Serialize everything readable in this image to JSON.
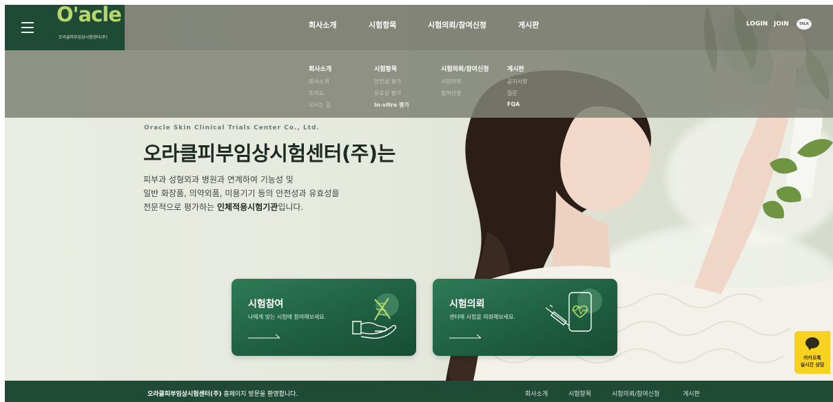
{
  "header": {
    "logo_text": "O'acle",
    "logo_sub": "오라클피부임상시험센터(주)",
    "nav": [
      "회사소개",
      "시험항목",
      "시험의뢰/참여신청",
      "게시판"
    ],
    "login": "LOGIN",
    "join": "JOIN",
    "talk": "TALK"
  },
  "dropdown": {
    "columns": [
      {
        "head": "회사소개",
        "items": [
          "회사소개",
          "조직도",
          "오시는 길"
        ]
      },
      {
        "head": "시험항목",
        "items": [
          "안전성 평가",
          "유효성 평가",
          "In-vitro 평가"
        ]
      },
      {
        "head": "시험의뢰/참여신청",
        "items": [
          "시험의뢰",
          "참여신청"
        ]
      },
      {
        "head": "게시판",
        "items": [
          "공지사항",
          "질문",
          "FQA"
        ]
      }
    ]
  },
  "hero": {
    "eng": "Oracle Skin Clinical Trials Center Co., Ltd.",
    "title": "오라클피부임상시험센터(주)는",
    "desc_line1": "피부과 성형외과 병원과 연계하여 기능성 및",
    "desc_line2": "일반 화장품, 의약외품, 미용기기 등의 안전성과 유효성을",
    "desc_line3_prefix": "전문적으로 평가하는 ",
    "desc_line3_bold": "인체적용시험기관",
    "desc_line3_suffix": "입니다."
  },
  "cards": [
    {
      "title": "시험참여",
      "desc": "나에게 맞는 시험에 참여해보세요."
    },
    {
      "title": "시험의뢰",
      "desc": "센터에 시험을 의뢰해보세요."
    }
  ],
  "kakao": {
    "line1": "카카오톡",
    "line2": "실시간 상담"
  },
  "footer": {
    "welcome_bold": "오라클피부임상시험센터(주)",
    "welcome_rest": " 홈페이지 방문을 환영합니다.",
    "links": [
      "회사소개",
      "시험항목",
      "시험의뢰/참여신청",
      "게시판"
    ]
  },
  "colors": {
    "brand_green": "#1f4a36",
    "card_green": "#2f7a57",
    "logo_green": "#b8d66a",
    "kakao_yellow": "#f7d21e"
  },
  "icons": [
    "hamburger-menu-icon",
    "dna-hand-icon",
    "phone-injection-icon",
    "kakao-chat-icon",
    "arrow-right-icon"
  ]
}
